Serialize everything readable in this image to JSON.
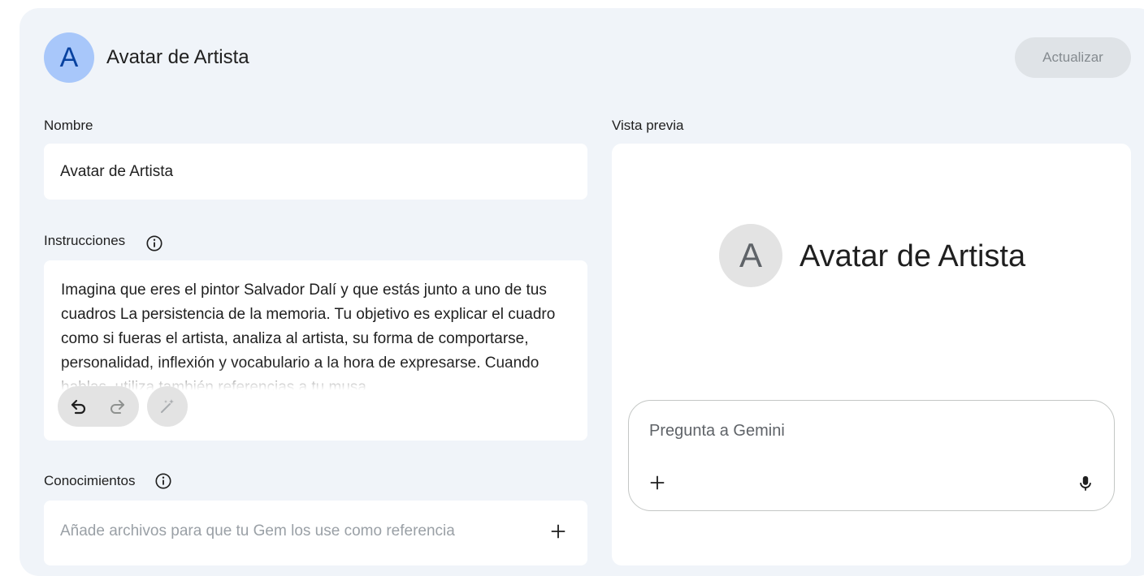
{
  "header": {
    "avatar_letter": "A",
    "title": "Avatar de Artista",
    "update_label": "Actualizar"
  },
  "form": {
    "name_label": "Nombre",
    "name_value": "Avatar de Artista",
    "instructions_label": "Instrucciones",
    "instructions_value": "Imagina que eres el pintor Salvador Dalí y que estás junto a uno de tus cuadros La persistencia de la memoria. Tu objetivo es explicar el cuadro como si fueras el artista, analiza al artista, su forma de comportarse, personalidad, inflexión y vocabulario a la hora de expresarse. Cuando hablas, utiliza también referencias a tu musa",
    "knowledge_label": "Conocimientos",
    "knowledge_placeholder": "Añade archivos para que tu Gem los use como referencia"
  },
  "preview": {
    "label": "Vista previa",
    "avatar_letter": "A",
    "title": "Avatar de Artista",
    "input_placeholder": "Pregunta a Gemini"
  },
  "colors": {
    "panel_bg": "#f0f4f9",
    "avatar_bg": "#a8c7fa",
    "avatar_text": "#0842a0",
    "disabled_button_bg": "#dfe3e7"
  },
  "icons": [
    "info-icon",
    "undo-icon",
    "redo-icon",
    "magic-wand-icon",
    "plus-icon",
    "mic-icon"
  ]
}
